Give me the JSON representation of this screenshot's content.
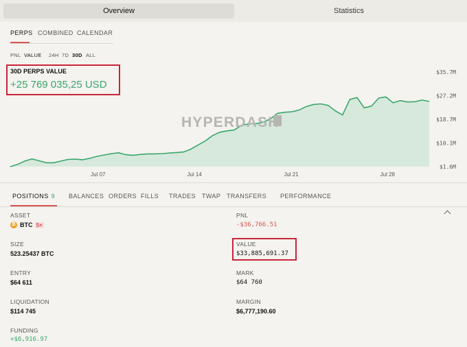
{
  "top_tabs": {
    "overview": "Overview",
    "statistics": "Statistics"
  },
  "sub_tabs": {
    "perps": "PERPS",
    "combined": "COMBINED",
    "calendar": "CALENDAR"
  },
  "range": {
    "pnl": "PNL",
    "value": "VALUE",
    "r24h": "24H",
    "r7d": "7D",
    "r30d": "30D",
    "all": "ALL",
    "selected": "30D"
  },
  "summary": {
    "title": "30D PERPS VALUE",
    "amount": "+25 769 035,25 USD"
  },
  "watermark": "HYPERDASH",
  "chart_data": {
    "type": "area",
    "x_tick_labels": [
      "Jul 07",
      "Jul 14",
      "Jul 21",
      "Jul 28"
    ],
    "y_tick_labels": [
      "$35.7M",
      "$27.2M",
      "$18.7M",
      "$10.1M",
      "$1.6M"
    ],
    "ylim": [
      1.6,
      35.7
    ],
    "line_color": "#3aa66a",
    "fill_color": "#d7e9dc",
    "values": [
      1.6,
      2.4,
      3.6,
      4.4,
      3.7,
      3.0,
      3.0,
      3.6,
      4.2,
      4.3,
      4.1,
      4.6,
      5.3,
      5.8,
      6.3,
      6.6,
      5.9,
      5.7,
      6.0,
      6.2,
      6.2,
      6.3,
      6.5,
      6.7,
      6.9,
      7.9,
      9.4,
      10.9,
      12.8,
      14.0,
      14.5,
      14.8,
      16.5,
      17.0,
      17.1,
      17.6,
      18.8,
      20.8,
      21.2,
      21.4,
      22.0,
      23.3,
      24.0,
      24.2,
      23.7,
      21.7,
      20.2,
      25.8,
      26.5,
      22.8,
      23.4,
      26.3,
      26.7,
      24.6,
      25.4,
      24.9,
      25.0,
      25.6,
      25.1
    ]
  },
  "positions_tabs": {
    "positions": "POSITIONS",
    "positions_count": "9",
    "balances": "BALANCES",
    "orders": "ORDERS",
    "fills": "FILLS",
    "trades": "TRADES",
    "twap": "TWAP",
    "transfers": "TRANSFERS",
    "performance": "PERFORMANCE"
  },
  "position": {
    "asset_label": "ASSET",
    "asset": "BTC",
    "leverage": "5×",
    "asset_icon": "bitcoin-icon",
    "pnl_label": "PNL",
    "pnl": "-$36,766.51",
    "size_label": "SIZE",
    "size": "523.25437 BTC",
    "value_label": "VALUE",
    "value": "$33,885,691.37",
    "entry_label": "ENTRY",
    "entry": "$64 611",
    "mark_label": "MARK",
    "mark": "$64 760",
    "liquidation_label": "LIQUIDATION",
    "liquidation": "$114 745",
    "margin_label": "MARGIN",
    "margin": "$6,777,190.60",
    "funding_label": "FUNDING",
    "funding": "+$6,916.97"
  }
}
